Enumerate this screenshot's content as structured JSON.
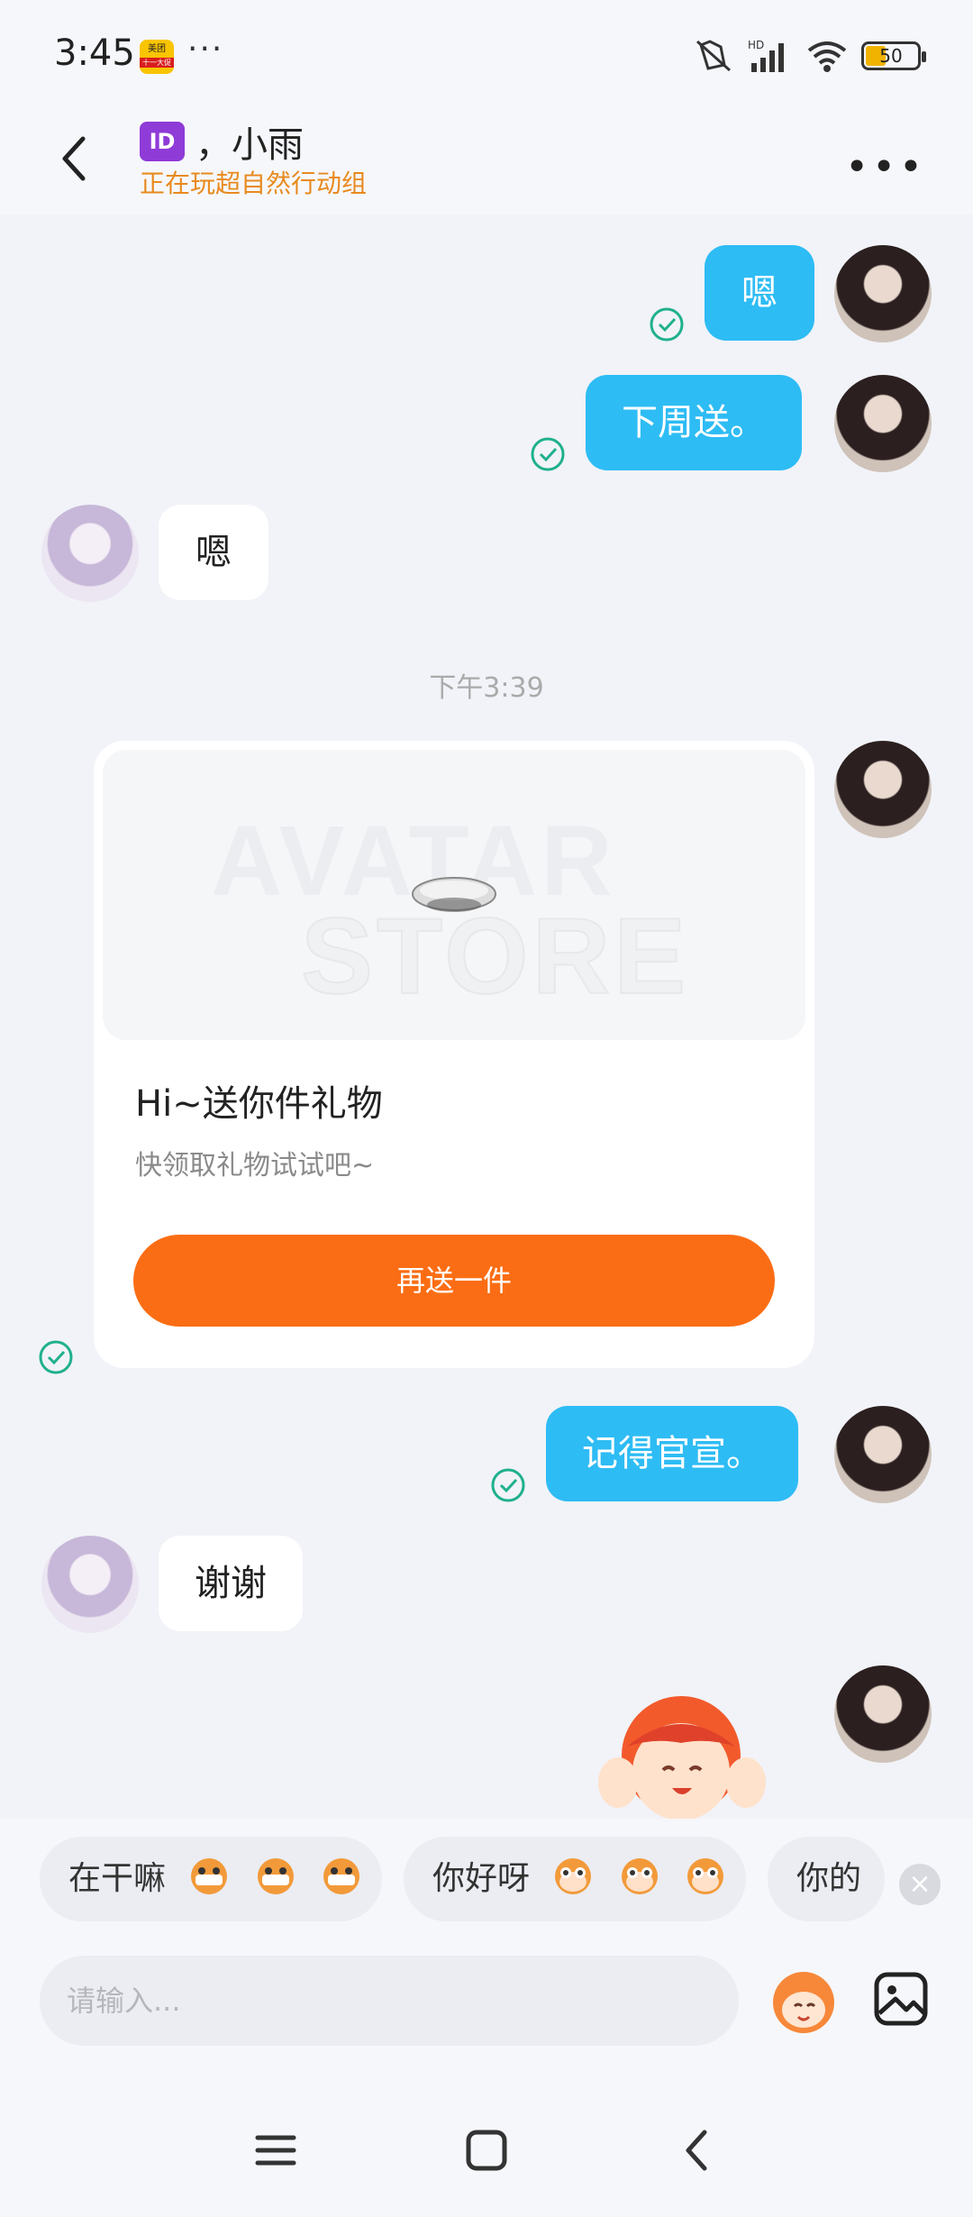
{
  "status_bar": {
    "time": "3:45",
    "app_icon_top": "美团",
    "app_icon_bottom": "十一大促",
    "overflow": "···",
    "battery": "50"
  },
  "header": {
    "id_badge": "ID",
    "title": "，小雨",
    "subtitle": "正在玩超自然行动组",
    "more": "•••"
  },
  "messages": {
    "m1": "嗯",
    "m2": "下周送。",
    "m3": "嗯",
    "time_sep": "下午3:39",
    "m5": "记得官宣。",
    "m6": "谢谢"
  },
  "gift_card": {
    "watermark_1": "AVATAR",
    "watermark_2": "STORE",
    "title": "Hi~送你件礼物",
    "subtitle": "快领取礼物试试吧~",
    "button": "再送一件"
  },
  "quick_replies": [
    {
      "text": "在干嘛"
    },
    {
      "text": "你好呀"
    },
    {
      "text": "你的"
    }
  ],
  "input": {
    "placeholder": "请输入..."
  },
  "colors": {
    "my_bubble": "#2ebcf4",
    "gift_button": "#fb6d14",
    "subtitle": "#e88a1f",
    "check": "#1fb08c"
  }
}
